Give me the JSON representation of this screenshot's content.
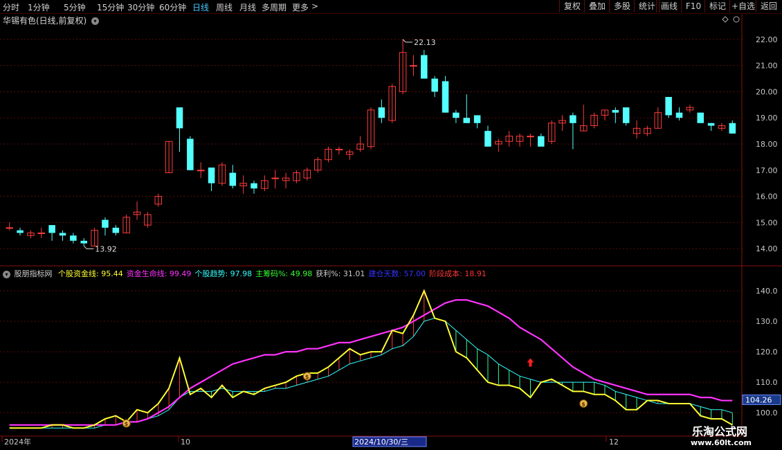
{
  "toolbar": {
    "periods": [
      "分时",
      "1分钟",
      "5分钟",
      "15分钟",
      "30分钟",
      "60分钟",
      "日线",
      "周线",
      "月线",
      "多周期",
      "更多"
    ],
    "active": "日线",
    "right_buttons": [
      "复权",
      "叠加",
      "多股",
      "统计",
      "画线",
      "F10",
      "标记",
      "+自选",
      "返回"
    ]
  },
  "main_chart": {
    "title": "华锡有色(日线,前复权)",
    "y_axis_ticks": [
      "22.00",
      "21.00",
      "20.00",
      "19.00",
      "18.00",
      "17.00",
      "16.00",
      "15.00",
      "14.00"
    ],
    "annotations": {
      "high": "22.13",
      "low": "13.92"
    }
  },
  "indicator": {
    "name": "股朋指标网",
    "fields": [
      {
        "label": "个股资金线:",
        "value": "95.44",
        "color": "#ffff33"
      },
      {
        "label": "资金生命线:",
        "value": "99.49",
        "color": "#ff33ff"
      },
      {
        "label": "个股趋势:",
        "value": "97.98",
        "color": "#33ffff"
      },
      {
        "label": "主筹码%:",
        "value": "49.98",
        "color": "#33ff33"
      },
      {
        "label": "获利%:",
        "value": "31.01",
        "color": "#cccccc"
      },
      {
        "label": "建仓天数:",
        "value": "57.00",
        "color": "#3333ff"
      },
      {
        "label": "阶段成本:",
        "value": "18.91",
        "color": "#ff3333"
      }
    ],
    "y_axis_ticks": [
      "140.0",
      "130.0",
      "120.0",
      "110.0",
      "100.0"
    ],
    "current_value": "104.26"
  },
  "x_axis": {
    "labels": [
      "2024年",
      "10",
      "2024/10/30/三",
      "12"
    ]
  },
  "watermark": {
    "name": "乐淘公式网",
    "url": "www.60lt.com"
  },
  "colors": {
    "up": "#ff3c3c",
    "down": "#54ffff",
    "fund_line": "#ffff33",
    "life_line": "#ff33ff",
    "trend_line": "#33ffff"
  },
  "chart_data": {
    "type": "candlestick",
    "ylim": [
      13.5,
      22.5
    ],
    "candles": [
      [
        14.8,
        14.8,
        15.0,
        14.7
      ],
      [
        14.7,
        14.6,
        14.8,
        14.5
      ],
      [
        14.5,
        14.6,
        14.7,
        14.4
      ],
      [
        14.6,
        14.6,
        14.8,
        14.4
      ],
      [
        14.9,
        14.6,
        14.9,
        14.3
      ],
      [
        14.6,
        14.5,
        14.7,
        14.3
      ],
      [
        14.5,
        14.3,
        14.6,
        14.2
      ],
      [
        14.3,
        14.2,
        14.4,
        14.1
      ],
      [
        14.1,
        14.7,
        14.8,
        14.1
      ],
      [
        15.1,
        14.8,
        15.2,
        14.5
      ],
      [
        14.8,
        14.6,
        14.9,
        14.5
      ],
      [
        14.6,
        15.2,
        15.3,
        14.6
      ],
      [
        15.3,
        15.4,
        15.8,
        15.1
      ],
      [
        14.9,
        15.3,
        15.4,
        14.8
      ],
      [
        15.7,
        16.0,
        16.1,
        15.6
      ],
      [
        16.9,
        18.1,
        18.1,
        16.9
      ],
      [
        19.4,
        18.6,
        19.4,
        17.7
      ],
      [
        18.2,
        17.0,
        18.3,
        17.0
      ],
      [
        17.0,
        17.0,
        17.3,
        16.7
      ],
      [
        17.1,
        16.5,
        17.1,
        16.2
      ],
      [
        16.5,
        17.2,
        17.3,
        16.4
      ],
      [
        16.9,
        16.4,
        17.2,
        16.3
      ],
      [
        16.4,
        16.5,
        16.8,
        16.1
      ],
      [
        16.5,
        16.3,
        16.6,
        16.1
      ],
      [
        16.3,
        16.6,
        16.8,
        16.2
      ],
      [
        16.7,
        16.7,
        17.0,
        16.3
      ],
      [
        16.6,
        16.7,
        16.9,
        16.3
      ],
      [
        16.6,
        16.9,
        17.0,
        16.5
      ],
      [
        16.7,
        17.0,
        17.1,
        16.6
      ],
      [
        17.0,
        17.4,
        17.5,
        16.9
      ],
      [
        17.4,
        17.8,
        17.9,
        17.3
      ],
      [
        17.8,
        17.8,
        17.9,
        17.6
      ],
      [
        17.6,
        17.7,
        17.8,
        17.4
      ],
      [
        17.8,
        18.0,
        18.3,
        17.7
      ],
      [
        17.9,
        19.3,
        19.4,
        17.8
      ],
      [
        19.4,
        19.0,
        19.7,
        18.8
      ],
      [
        18.9,
        20.2,
        20.3,
        18.8
      ],
      [
        20.0,
        21.5,
        22.0,
        19.9
      ],
      [
        21.0,
        21.0,
        21.4,
        20.6
      ],
      [
        21.4,
        20.5,
        21.6,
        20.5
      ],
      [
        20.5,
        20.0,
        20.6,
        19.8
      ],
      [
        20.4,
        19.2,
        20.6,
        19.2
      ],
      [
        19.2,
        19.0,
        19.3,
        18.8
      ],
      [
        19.0,
        18.8,
        19.9,
        18.8
      ],
      [
        19.1,
        18.8,
        19.1,
        18.6
      ],
      [
        18.5,
        17.9,
        18.7,
        17.9
      ],
      [
        18.0,
        18.1,
        18.2,
        17.7
      ],
      [
        18.1,
        18.3,
        18.5,
        17.9
      ],
      [
        18.1,
        18.3,
        18.4,
        17.9
      ],
      [
        18.3,
        18.3,
        18.4,
        17.9
      ],
      [
        18.3,
        17.9,
        18.4,
        17.9
      ],
      [
        18.1,
        18.8,
        18.9,
        18.0
      ],
      [
        18.8,
        18.9,
        19.1,
        18.5
      ],
      [
        19.1,
        18.8,
        19.2,
        17.8
      ],
      [
        18.5,
        18.7,
        19.5,
        18.5
      ],
      [
        18.7,
        19.1,
        19.2,
        18.6
      ],
      [
        19.1,
        19.3,
        19.3,
        18.9
      ],
      [
        19.3,
        19.2,
        19.4,
        18.8
      ],
      [
        19.4,
        18.8,
        19.4,
        18.7
      ],
      [
        18.4,
        18.6,
        18.9,
        18.2
      ],
      [
        18.4,
        18.6,
        18.7,
        18.3
      ],
      [
        18.6,
        19.2,
        19.4,
        18.6
      ],
      [
        19.8,
        19.1,
        19.8,
        19.0
      ],
      [
        19.2,
        19.0,
        19.4,
        18.9
      ],
      [
        19.3,
        19.4,
        19.5,
        19.2
      ],
      [
        19.2,
        18.8,
        19.2,
        18.8
      ],
      [
        18.8,
        18.7,
        18.8,
        18.5
      ],
      [
        18.6,
        18.7,
        18.8,
        18.5
      ],
      [
        18.8,
        18.4,
        18.9,
        18.4
      ]
    ],
    "indicator_ylim": [
      93,
      145
    ],
    "fund_line": [
      95,
      95,
      95,
      95,
      96,
      96,
      95,
      95,
      96,
      98,
      99,
      97,
      101,
      100,
      103,
      108,
      118,
      106,
      108,
      105,
      109,
      105,
      107,
      106,
      108,
      109,
      110,
      112,
      113,
      113,
      115,
      118,
      121,
      119,
      120,
      120,
      127,
      126,
      132,
      140,
      131,
      130,
      120,
      118,
      114,
      110,
      109,
      109,
      108,
      105,
      110,
      111,
      109,
      107,
      107,
      106,
      106,
      104,
      101,
      101,
      104,
      104,
      103,
      103,
      103,
      99,
      98,
      98,
      96
    ],
    "life_line": [
      96,
      96,
      96,
      96,
      96,
      96,
      96,
      96,
      96,
      96,
      96,
      97,
      97,
      98,
      100,
      102,
      105,
      108,
      110,
      112,
      114,
      116,
      117,
      118,
      119,
      119,
      120,
      120,
      121,
      121,
      122,
      123,
      123,
      124,
      125,
      126,
      127,
      128,
      130,
      132,
      134,
      136,
      137,
      137,
      136,
      135,
      133,
      131,
      128,
      126,
      124,
      121,
      118,
      115,
      113,
      111,
      110,
      109,
      108,
      107,
      106,
      106,
      106,
      106,
      106,
      105,
      105,
      104,
      104
    ],
    "trend_line": [
      95,
      95,
      95,
      95,
      95,
      95,
      95,
      95,
      95,
      96,
      96,
      97,
      97,
      98,
      99,
      101,
      105,
      107,
      107,
      107,
      108,
      107,
      107,
      107,
      107,
      108,
      108,
      109,
      110,
      111,
      112,
      114,
      116,
      117,
      118,
      119,
      121,
      122,
      125,
      130,
      131,
      130,
      127,
      124,
      121,
      119,
      116,
      114,
      112,
      111,
      110,
      110,
      110,
      110,
      110,
      110,
      109,
      107,
      106,
      105,
      104,
      103,
      103,
      103,
      103,
      102,
      101,
      101,
      100
    ]
  }
}
